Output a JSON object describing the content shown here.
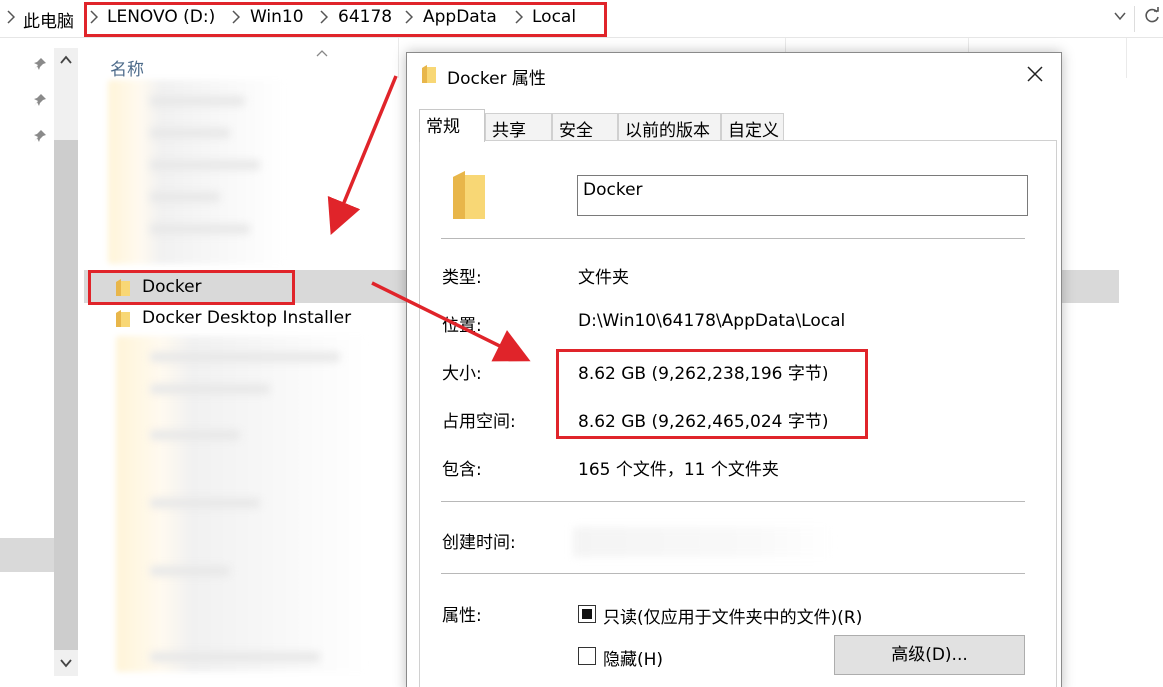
{
  "breadcrumb": {
    "items": [
      "此电脑",
      "LENOVO (D:)",
      "Win10",
      "64178",
      "AppData",
      "Local"
    ]
  },
  "file_list": {
    "column_name": "名称",
    "items": [
      {
        "name": "Docker",
        "selected": true
      },
      {
        "name": "Docker Desktop Installer",
        "selected": false
      }
    ]
  },
  "dialog": {
    "title": "Docker 属性",
    "tabs": [
      "常规",
      "共享",
      "安全",
      "以前的版本",
      "自定义"
    ],
    "active_tab": "常规",
    "folder_name": "Docker",
    "properties": {
      "type_label": "类型:",
      "type_value": "文件夹",
      "location_label": "位置:",
      "location_value": "D:\\Win10\\64178\\AppData\\Local",
      "size_label": "大小:",
      "size_value": "8.62 GB (9,262,238,196 字节)",
      "disk_size_label": "占用空间:",
      "disk_size_value": "8.62 GB (9,262,465,024 字节)",
      "contains_label": "包含:",
      "contains_value": "165 个文件，11 个文件夹",
      "created_label": "创建时间:",
      "attributes_label": "属性:",
      "readonly_label": "只读(仅应用于文件夹中的文件)(R)",
      "readonly_state": "indeterminate",
      "hidden_label": "隐藏(H)",
      "hidden_checked": false,
      "advanced_button": "高级(D)..."
    }
  },
  "colors": {
    "highlight": "#e0242a",
    "folder": "#f8d775",
    "selection": "#d9d9d9"
  }
}
